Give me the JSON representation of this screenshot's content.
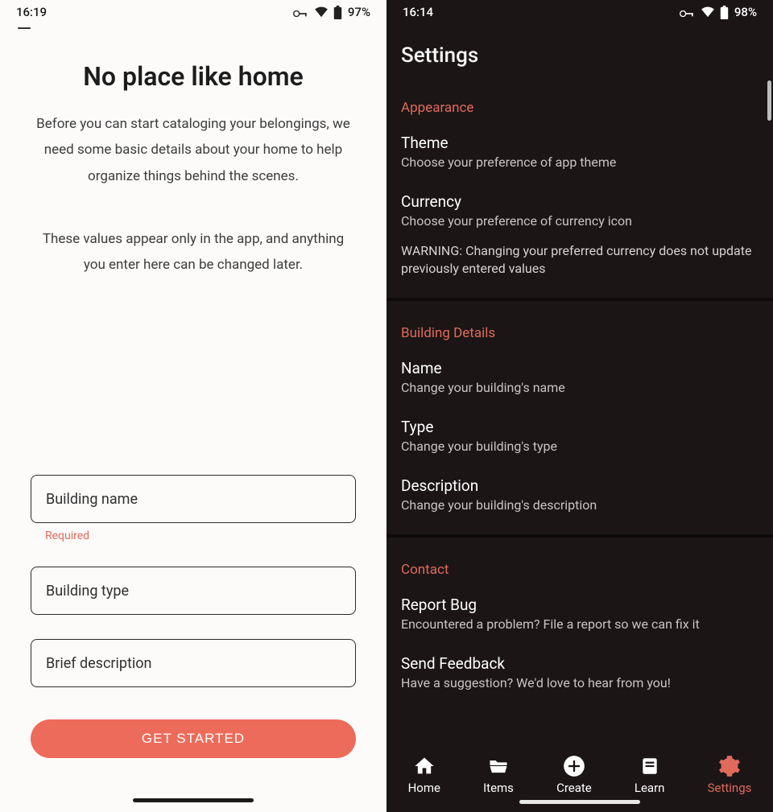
{
  "left": {
    "status": {
      "time": "16:19",
      "battery": "97%"
    },
    "title": "No place like home",
    "para1": "Before you can start cataloging your belongings, we need some basic details about your home to help organize things behind the scenes.",
    "para2": "These values appear only in the app, and anything you enter here can be changed later.",
    "fields": {
      "name": {
        "label": "Building name",
        "helper": "Required"
      },
      "type": {
        "label": "Building type"
      },
      "desc": {
        "label": "Brief description"
      }
    },
    "cta": "GET STARTED"
  },
  "right": {
    "status": {
      "time": "16:14",
      "battery": "98%"
    },
    "title": "Settings",
    "sections": {
      "appearance": {
        "header": "Appearance",
        "theme": {
          "title": "Theme",
          "sub": "Choose your preference of app theme"
        },
        "currency": {
          "title": "Currency",
          "sub": "Choose your preference of currency icon",
          "warn": "WARNING: Changing your preferred currency does not update previously entered values"
        }
      },
      "building": {
        "header": "Building Details",
        "name": {
          "title": "Name",
          "sub": "Change your building's name"
        },
        "type": {
          "title": "Type",
          "sub": "Change your building's type"
        },
        "desc": {
          "title": "Description",
          "sub": "Change your building's description"
        }
      },
      "contact": {
        "header": "Contact",
        "bug": {
          "title": "Report Bug",
          "sub": "Encountered a problem? File a report so we can fix it"
        },
        "feedback": {
          "title": "Send Feedback",
          "sub": "Have a suggestion? We'd love to hear from you!"
        }
      }
    },
    "nav": {
      "home": "Home",
      "items": "Items",
      "create": "Create",
      "learn": "Learn",
      "settings": "Settings"
    }
  }
}
